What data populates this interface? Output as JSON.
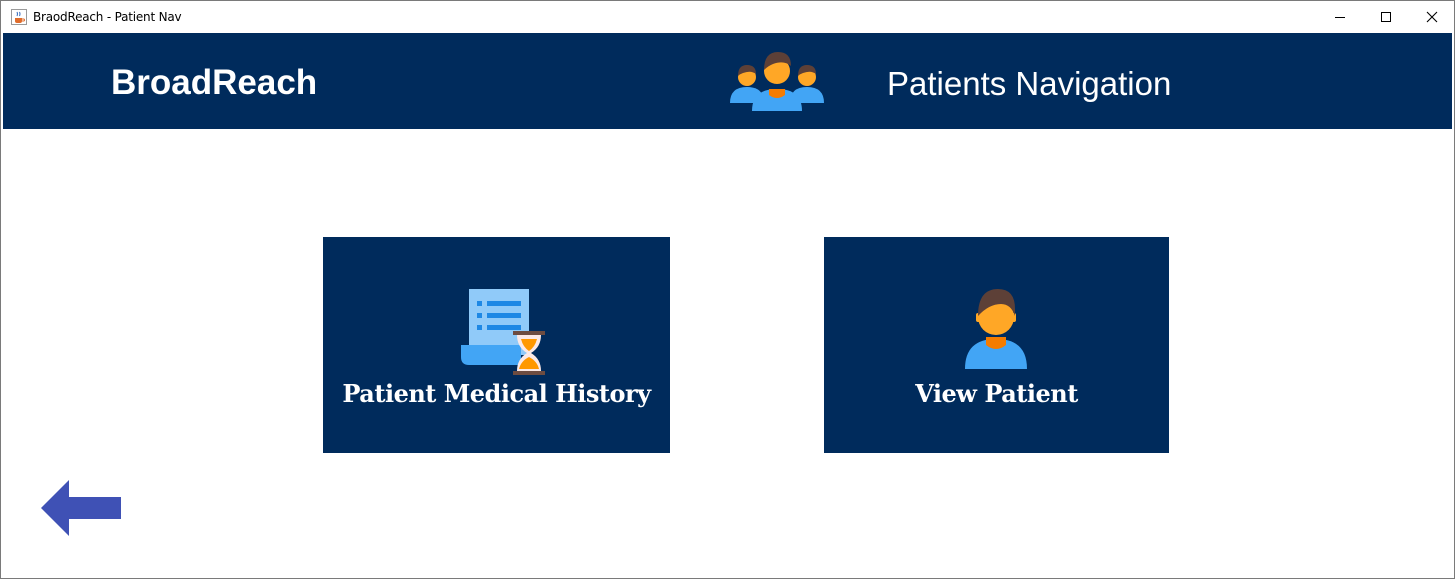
{
  "window": {
    "title": "BraodReach - Patient Nav",
    "icon": "java-cup-icon"
  },
  "header": {
    "brand": "BroadReach",
    "icon": "patients-group-icon",
    "title": "Patients Navigation"
  },
  "tiles": [
    {
      "label": "Patient Medical History",
      "icon": "medical-history-icon"
    },
    {
      "label": "View Patient",
      "icon": "patient-icon"
    }
  ],
  "back": {
    "icon": "back-arrow-icon"
  },
  "colors": {
    "navy": "#002b5c",
    "arrow": "#3f51b5",
    "skin": "#ffa726",
    "shirt": "#42a5f5",
    "hair": "#5d4037"
  }
}
